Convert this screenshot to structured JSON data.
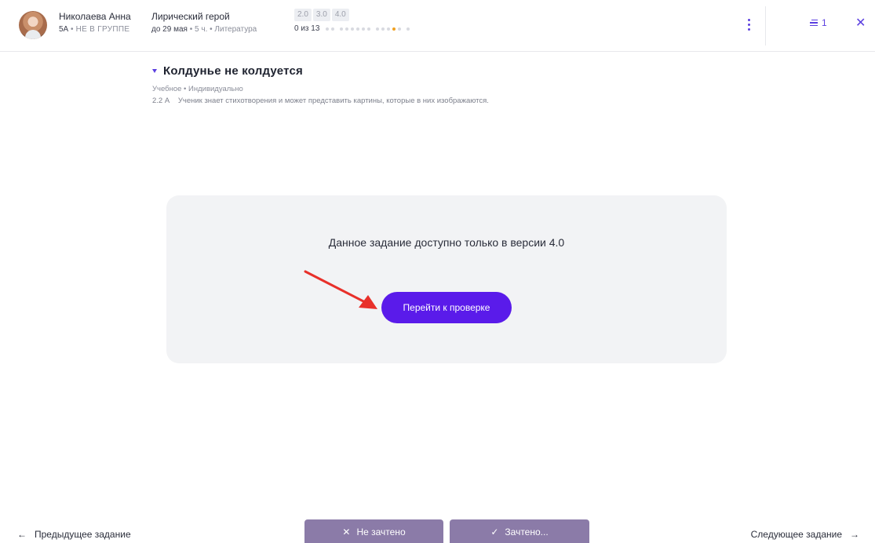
{
  "header": {
    "student_name": "Николаева Анна",
    "student_class": "5А",
    "student_group": "НЕ В ГРУППЕ",
    "topic_title": "Лирический герой",
    "topic_deadline": "до 29 мая",
    "topic_hours": "5 ч.",
    "topic_subject": "Литература",
    "versions": [
      "2.0",
      "3.0",
      "4.0"
    ],
    "progress_count": "0 из 13",
    "list_count": "1",
    "icons": {
      "menu": "kebab-menu-icon",
      "list": "list-icon",
      "close": "close-icon"
    }
  },
  "task": {
    "title": "Колдунье не колдуется",
    "type": "Учебное • Индивидуально",
    "code": "2.2 А",
    "description": "Ученик знает стихотворения и может представить картины, которые в них изображаются."
  },
  "panel": {
    "message": "Данное задание доступно только в версии 4.0",
    "button_label": "Перейти к проверке"
  },
  "footer": {
    "prev_label": "Предыдущее задание",
    "next_label": "Следующее задание",
    "fail_label": "Не зачтено",
    "pass_label": "Зачтено..."
  },
  "colors": {
    "accent": "#5a1bea",
    "grade_button": "#8b7ba8",
    "annotation_arrow": "#e8302a"
  }
}
